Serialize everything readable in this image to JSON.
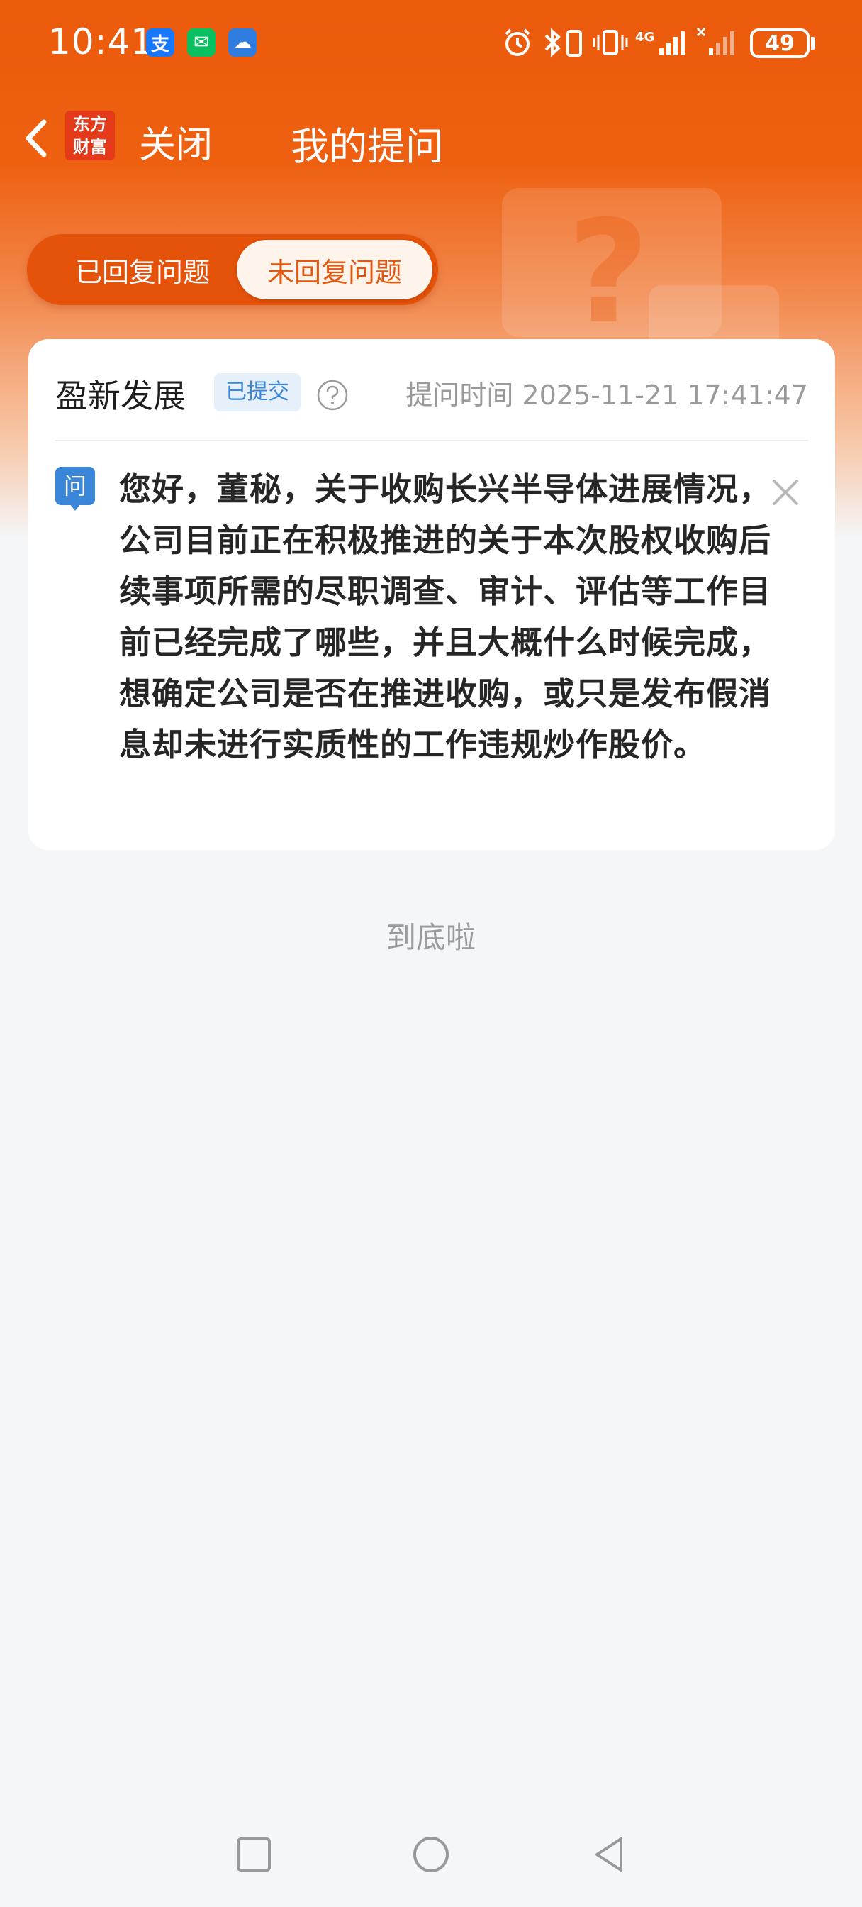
{
  "status_bar": {
    "time": "10:41",
    "app_badges": [
      {
        "name": "alipay",
        "glyph": "支",
        "color": "#1677ff"
      },
      {
        "name": "wechat",
        "glyph": "✉",
        "color": "#07c160"
      },
      {
        "name": "weather",
        "glyph": "☁",
        "color": "#2f7de1"
      }
    ],
    "network": "4G",
    "battery": "49"
  },
  "nav": {
    "brand_line1": "东方",
    "brand_line2": "财富",
    "close_label": "关闭",
    "title": "我的提问"
  },
  "tabs": [
    {
      "label": "已回复问题",
      "selected": false
    },
    {
      "label": "未回复问题",
      "selected": true
    }
  ],
  "question_card": {
    "company": "盈新发展",
    "status": "已提交",
    "time": "提问时间 2025-11-21 17:41:47",
    "ask_label": "问",
    "content": "您好，董秘，关于收购长兴半导体进展情况，公司目前正在积极推进的关于本次股权收购后续事项所需的尽职调查、审计、评估等工作目前已经完成了哪些，并且大概什么时候完成，想确定公司是否在推进收购，或只是发布假消息却未进行实质性的工作违规炒作股价。"
  },
  "footer": {
    "end_text": "到底啦"
  },
  "colors": {
    "brand_orange": "#ec5a0c",
    "badge_blue": "#3a86d8",
    "page_bg": "#f5f6f8"
  }
}
